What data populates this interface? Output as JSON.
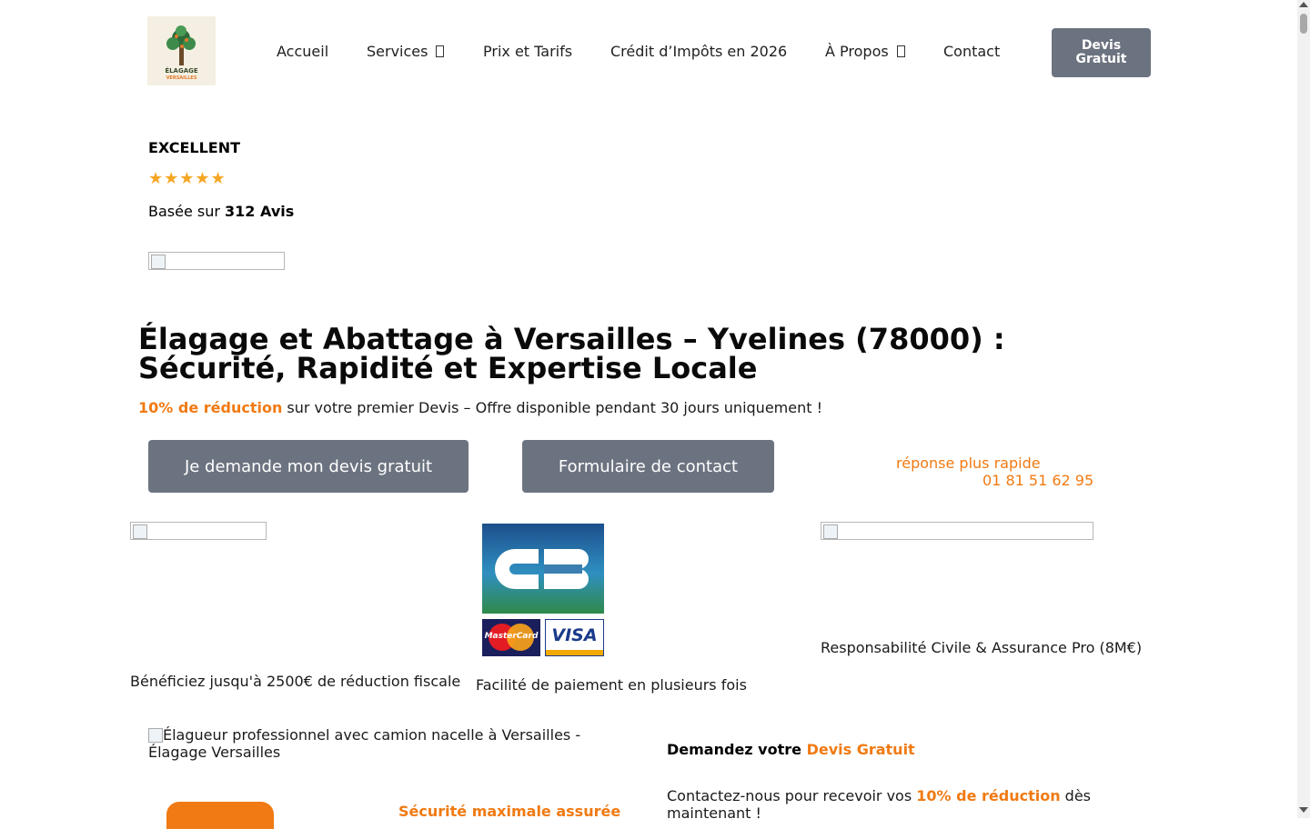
{
  "header": {
    "logo_text_line1": "ÉLAGAGE",
    "logo_text_line2": "VERSAILLES",
    "nav": [
      {
        "label": "Accueil",
        "has_caret": false
      },
      {
        "label": "Services",
        "has_caret": true
      },
      {
        "label": "Prix et Tarifs",
        "has_caret": false
      },
      {
        "label": "Crédit d’Impôts en 2026",
        "has_caret": false
      },
      {
        "label": "À Propos",
        "has_caret": true
      },
      {
        "label": "Contact",
        "has_caret": false
      }
    ],
    "cta_line1": "Devis",
    "cta_line2": "Gratuit"
  },
  "rating": {
    "title": "EXCELLENT",
    "stars": "★★★★★",
    "based_prefix": "Basée sur ",
    "based_count": "312 Avis"
  },
  "hero": {
    "title": "Élagage et Abattage à Versailles – Yvelines (78000) : Sécurité, Rapidité et Expertise Locale",
    "promo_highlight": "10% de réduction",
    "promo_rest": " sur votre premier Devis – Offre disponible pendant 30 jours uniquement !",
    "button_quote": "Je demande mon devis gratuit",
    "button_contact": "Formulaire de contact",
    "phone_label": "réponse plus rapide",
    "phone_number": "01 81 51 62 95"
  },
  "trust": {
    "tax_text": "Bénéficiez jusqu'à 2500€ de réduction fiscale",
    "payment_text": "Facilité de paiement en plusieurs fois",
    "insurance_text": "Responsabilité Civile & Assurance Pro (8M€)",
    "card_labels": [
      "MasterCard",
      "VISA"
    ]
  },
  "section": {
    "image_alt": "Élagueur professionnel avec camion nacelle à Versailles - Élagage Versailles",
    "secure_title": "Sécurité maximale assurée",
    "demandez_prefix": "Demandez votre ",
    "demandez_highlight": "Devis Gratuit",
    "contact_prefix": "Contactez-nous pour recevoir vos ",
    "contact_highlight": "10% de réduction",
    "contact_suffix": " dès maintenant !"
  },
  "colors": {
    "accent": "#f07a13",
    "button_gray": "#6c7380",
    "star": "#f5a623"
  }
}
